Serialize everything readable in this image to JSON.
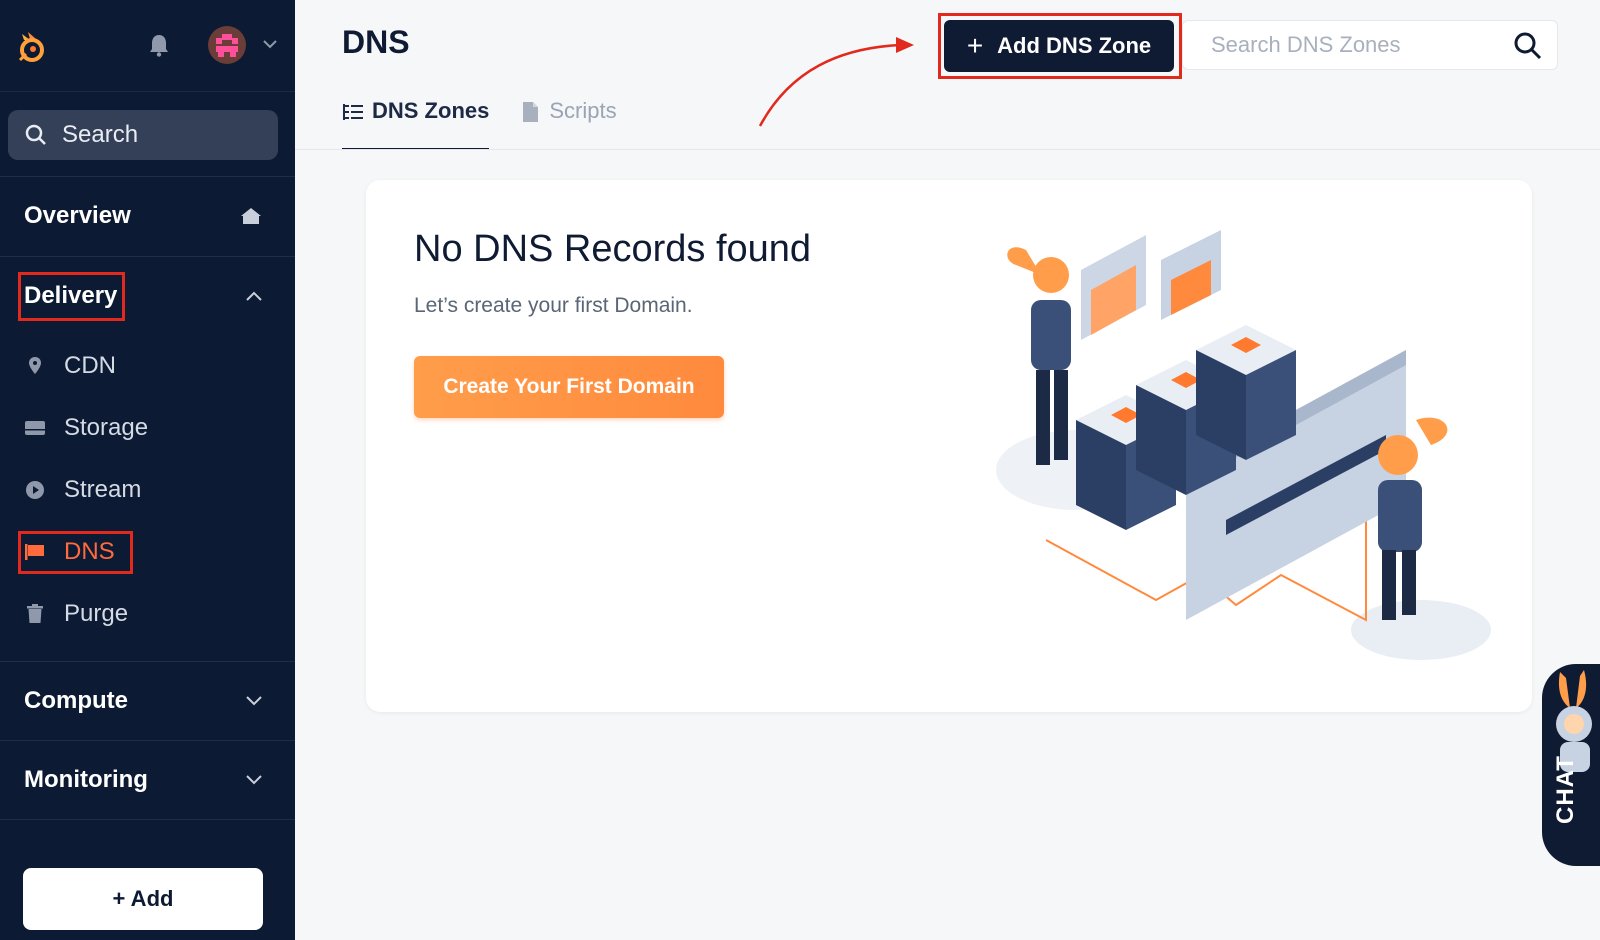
{
  "sidebar": {
    "search_label": "Search",
    "overview": "Overview",
    "delivery": "Delivery",
    "items": [
      {
        "label": "CDN",
        "icon": "map-pin-icon"
      },
      {
        "label": "Storage",
        "icon": "storage-icon"
      },
      {
        "label": "Stream",
        "icon": "play-icon"
      },
      {
        "label": "DNS",
        "icon": "flag-icon"
      },
      {
        "label": "Purge",
        "icon": "trash-icon"
      }
    ],
    "compute": "Compute",
    "monitoring": "Monitoring",
    "add_label": "+ Add"
  },
  "header": {
    "title": "DNS",
    "add_zone_label": "Add DNS Zone",
    "add_zone_plus": "+",
    "search_placeholder": "Search DNS Zones"
  },
  "tabs": [
    {
      "label": "DNS Zones",
      "active": true
    },
    {
      "label": "Scripts",
      "active": false
    }
  ],
  "empty_state": {
    "title": "No DNS Records found",
    "subtitle": "Let’s create your first Domain.",
    "cta": "Create Your First Domain"
  },
  "chat": {
    "label": "CHAT"
  },
  "colors": {
    "sidebar_bg": "#0d1a33",
    "accent": "#ff8a3d",
    "active_item": "#ff6b3d",
    "highlight_box": "#e12a1d"
  }
}
